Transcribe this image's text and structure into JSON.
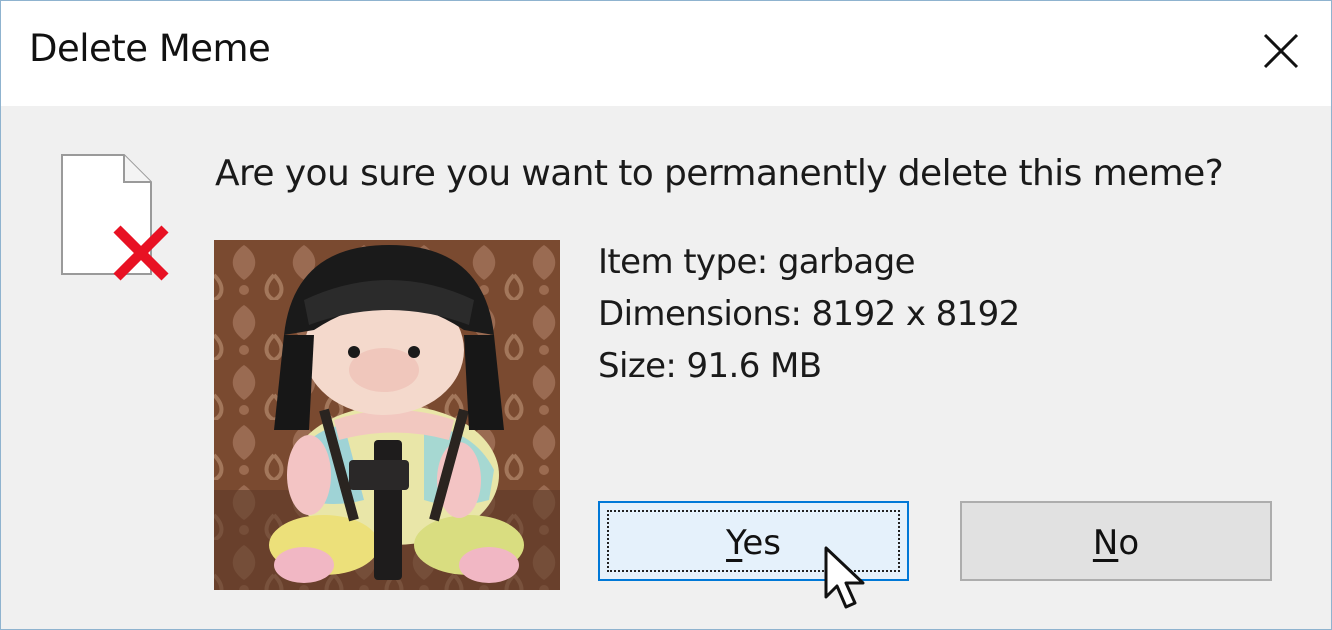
{
  "window": {
    "title": "Delete Meme",
    "close_icon": "close-icon"
  },
  "dialog": {
    "icon": "file-delete-icon",
    "question": "Are you sure you want to permanently delete this meme?",
    "details": {
      "item_type": "Item type: garbage",
      "dimensions": "Dimensions: 8192 x 8192",
      "size": "Size: 91.6 MB"
    }
  },
  "buttons": {
    "yes": {
      "accel": "Y",
      "rest": "es"
    },
    "no": {
      "accel": "N",
      "rest": "o"
    }
  },
  "colors": {
    "accent": "#0078d7",
    "delete_x": "#e81123",
    "dialog_bg": "#f0f0f0"
  }
}
